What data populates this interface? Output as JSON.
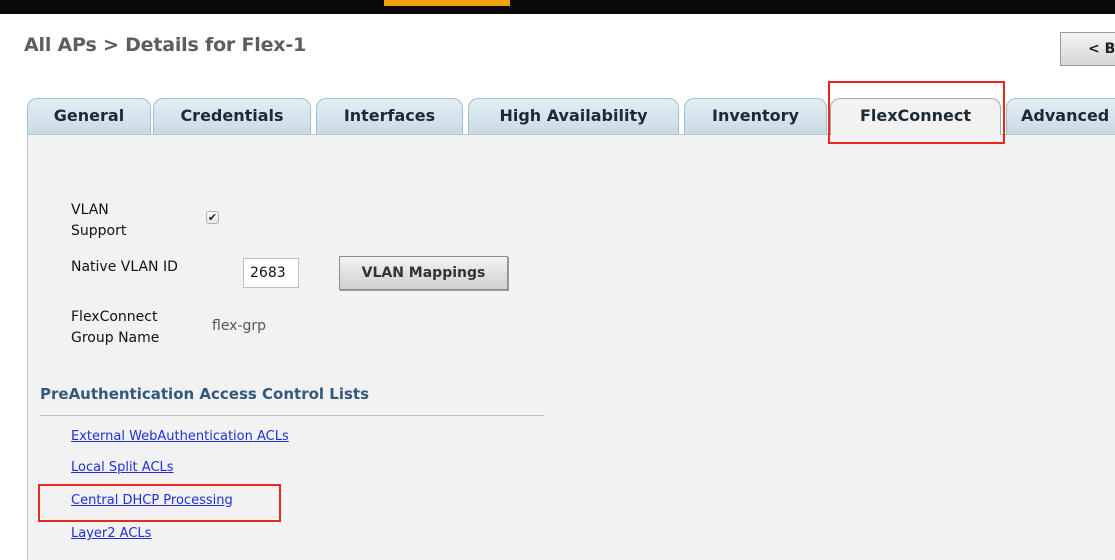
{
  "breadcrumb": "All APs > Details for Flex-1",
  "back_button": "< B",
  "tabs": [
    {
      "label": "General"
    },
    {
      "label": "Credentials"
    },
    {
      "label": "Interfaces"
    },
    {
      "label": "High Availability"
    },
    {
      "label": "Inventory"
    },
    {
      "label": "FlexConnect"
    },
    {
      "label": "Advanced"
    }
  ],
  "form": {
    "vlan_support_label_1": "VLAN",
    "vlan_support_label_2": "Support",
    "vlan_support_checked": true,
    "native_vlan_label": "Native VLAN ID",
    "native_vlan_value": "2683",
    "vlan_mappings_button": "VLAN Mappings",
    "group_name_label_1": "FlexConnect",
    "group_name_label_2": "Group Name",
    "group_name_value": "flex-grp"
  },
  "preauth": {
    "title": "PreAuthentication Access Control Lists",
    "links": [
      "External WebAuthentication ACLs",
      "Local Split ACLs",
      "Central DHCP Processing",
      "Layer2 ACLs"
    ]
  },
  "colors": {
    "highlight": "#e8281e",
    "link": "#1f2fd6",
    "section_title": "#34597a",
    "top_accent": "#f0a30a"
  }
}
